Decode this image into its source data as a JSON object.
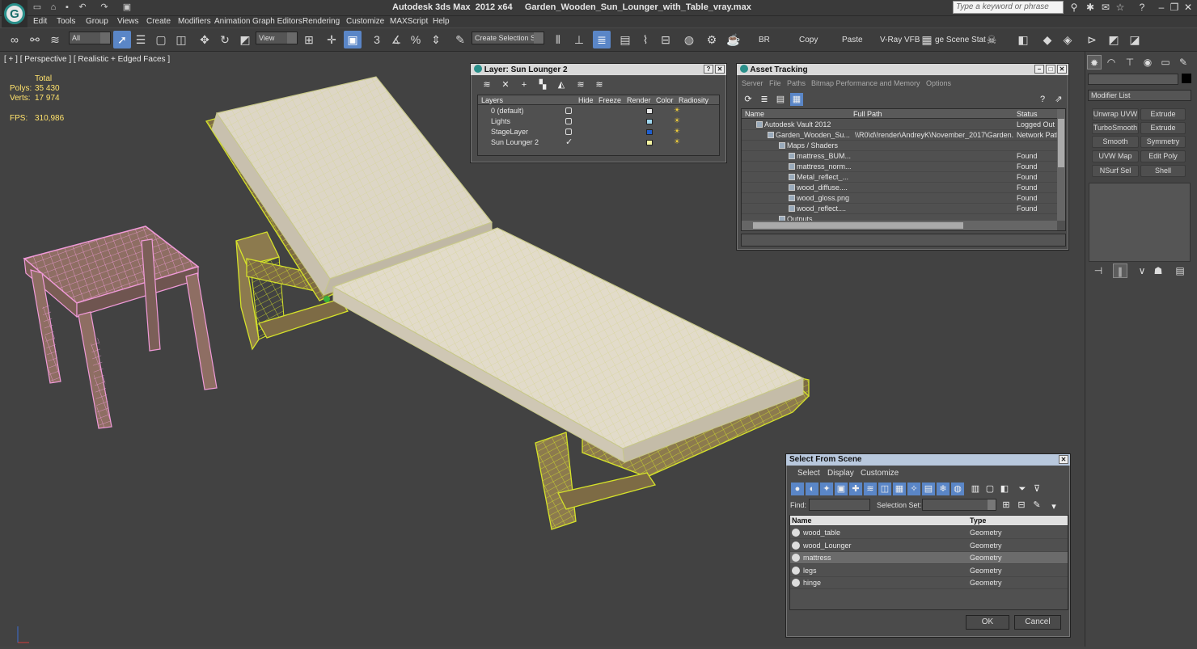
{
  "app": {
    "title": "Autodesk 3ds Max  2012 x64     Garden_Wooden_Sun_Lounger_with_Table_vray.max",
    "search_placeholder": "Type a keyword or phrase"
  },
  "menu": [
    "Edit",
    "Tools",
    "Group",
    "Views",
    "Create",
    "Modifiers",
    "Animation",
    "Graph Editors",
    "Rendering",
    "Customize",
    "MAXScript",
    "Help"
  ],
  "toolbar": {
    "filter_value": "All",
    "ref_coord": "View",
    "selection_set": "Create Selection Se",
    "btn_br": "BR",
    "btn_copy": "Copy",
    "btn_paste": "Paste",
    "btn_vray": "V-Ray VFB",
    "btn_stat": "ge Scene Stat"
  },
  "viewport": {
    "label": "[ + ] [ Perspective ] [ Realistic + Edged Faces ]",
    "stats": {
      "total_label": "Total",
      "polys_label": "Polys:",
      "polys_value": "35 430",
      "verts_label": "Verts:",
      "verts_value": "17 974",
      "fps_label": "FPS:",
      "fps_value": "310,986"
    }
  },
  "layer_dialog": {
    "title": "Layer: Sun Lounger 2",
    "columns": [
      "Layers",
      "Hide",
      "Freeze",
      "Render",
      "Color",
      "Radiosity"
    ],
    "rows": [
      {
        "name": "0 (default)",
        "color": "#e8e8e8"
      },
      {
        "name": "Lights",
        "color": "#a0d8f0"
      },
      {
        "name": "StageLayer",
        "color": "#1f5fd0"
      },
      {
        "name": "Sun Lounger 2",
        "color": "#f4f3a0"
      }
    ]
  },
  "asset_tracking": {
    "title": "Asset Tracking",
    "menu": [
      "Server",
      "File",
      "Paths",
      "Bitmap Performance and Memory",
      "Options"
    ],
    "columns": [
      "Name",
      "Full Path",
      "Status"
    ],
    "rows": [
      {
        "name": "Autodesk Vault 2012",
        "path": "",
        "status": "Logged Out"
      },
      {
        "name": "Garden_Wooden_Su...",
        "path": "\\\\R0\\d\\!render\\AndreyK\\November_2017\\Garden...",
        "status": "Network Path"
      },
      {
        "name": "Maps / Shaders",
        "path": "",
        "status": ""
      },
      {
        "name": "mattress_BUM...",
        "path": "",
        "status": "Found"
      },
      {
        "name": "mattress_norm...",
        "path": "",
        "status": "Found"
      },
      {
        "name": "Metal_reflect_...",
        "path": "",
        "status": "Found"
      },
      {
        "name": "wood_diffuse....",
        "path": "",
        "status": "Found"
      },
      {
        "name": "wood_gloss.png",
        "path": "",
        "status": "Found"
      },
      {
        "name": "wood_reflect....",
        "path": "",
        "status": "Found"
      },
      {
        "name": "Outputs",
        "path": "",
        "status": ""
      }
    ]
  },
  "select_from_scene": {
    "title": "Select From Scene",
    "menu": [
      "Select",
      "Display",
      "Customize"
    ],
    "find_label": "Find:",
    "selset_label": "Selection Set:",
    "columns": [
      "Name",
      "Type"
    ],
    "rows": [
      {
        "name": "wood_table",
        "type": "Geometry"
      },
      {
        "name": "wood_Lounger",
        "type": "Geometry"
      },
      {
        "name": "mattress",
        "type": "Geometry"
      },
      {
        "name": "legs",
        "type": "Geometry"
      },
      {
        "name": "hinge",
        "type": "Geometry"
      }
    ],
    "ok_label": "OK",
    "cancel_label": "Cancel"
  },
  "command_panel": {
    "modifier_list": "Modifier List",
    "buttons": [
      "Unwrap UVW",
      "Extrude",
      "TurboSmooth",
      "Extrude",
      "Smooth",
      "Symmetry",
      "UVW Map",
      "Edit Poly",
      "NSurf Sel",
      "Shell"
    ]
  },
  "colors": {
    "lounger_wire": "#d5e22a",
    "table_wire": "#f09ad8",
    "accent": "#5a86c7"
  }
}
